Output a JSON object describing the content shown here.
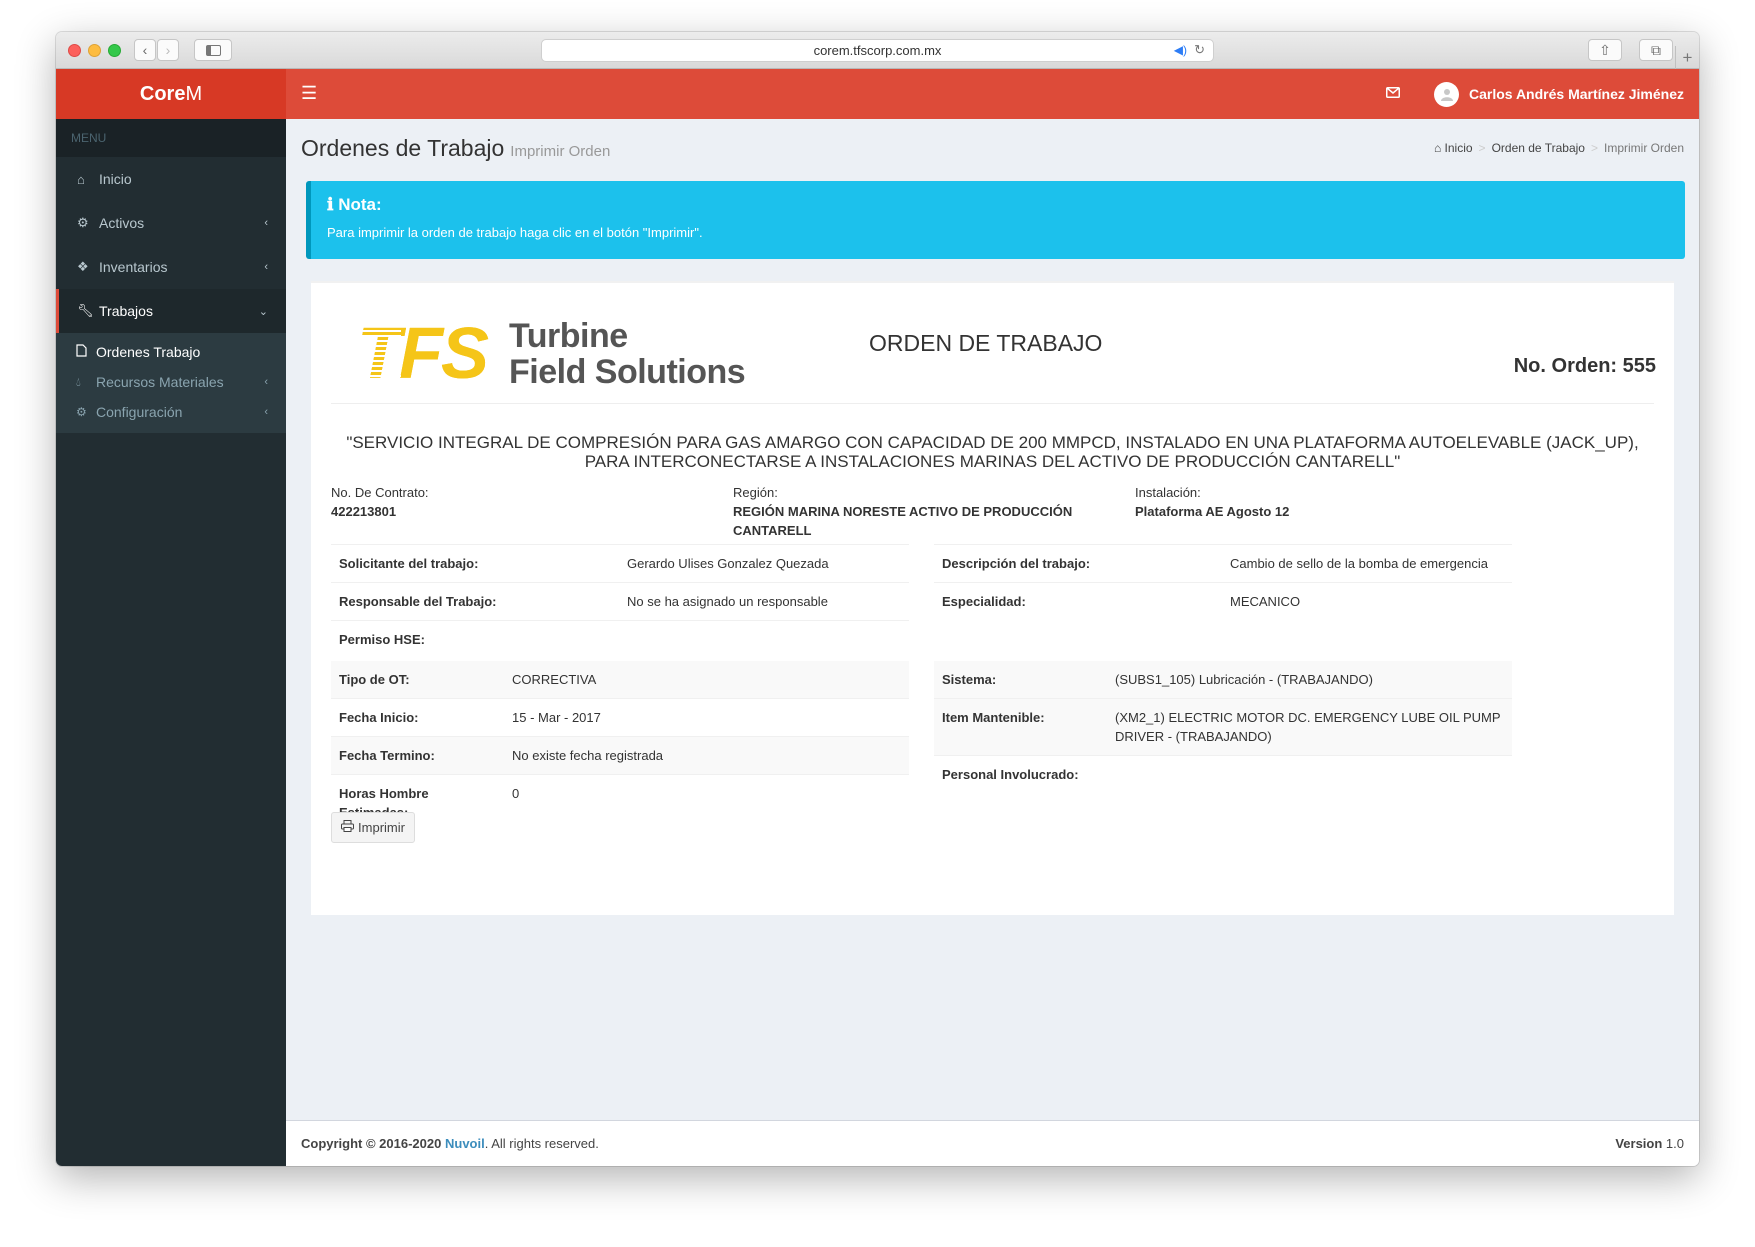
{
  "browser": {
    "url": "corem.tfscorp.com.mx"
  },
  "header": {
    "logo_bold": "Core",
    "logo_light": "M",
    "user_name": "Carlos Andrés Martínez Jiménez"
  },
  "sidebar": {
    "menu_header": "MENU",
    "items": [
      {
        "label": "Inicio",
        "icon": "home-icon"
      },
      {
        "label": "Activos",
        "icon": "cogs-icon"
      },
      {
        "label": "Inventarios",
        "icon": "cubes-icon"
      },
      {
        "label": "Trabajos",
        "icon": "wrench-icon"
      }
    ],
    "subitems": [
      {
        "label": "Ordenes Trabajo",
        "icon": "file-icon"
      },
      {
        "label": "Recursos Materiales",
        "icon": "drop-icon"
      },
      {
        "label": "Configuración",
        "icon": "gear-icon"
      }
    ]
  },
  "page": {
    "title": "Ordenes de Trabajo",
    "subtitle": "Imprimir Orden",
    "breadcrumb": [
      "Inicio",
      "Orden de Trabajo",
      "Imprimir Orden"
    ]
  },
  "note": {
    "title": "Nota:",
    "text": "Para imprimir la orden de trabajo haga clic en el botón \"Imprimir\"."
  },
  "order": {
    "company_logo_letters": "TFS",
    "company_name_1": "Turbine",
    "company_name_2": "Field Solutions",
    "doc_title": "ORDEN DE TRABAJO",
    "number": "No. Orden: 555",
    "project": "\"SERVICIO INTEGRAL DE COMPRESIÓN PARA GAS AMARGO CON CAPACIDAD DE 200 MMPCD, INSTALADO EN UNA PLATAFORMA AUTOELEVABLE (JACK_UP), PARA INTERCONECTARSE A INSTALACIONES MARINAS DEL ACTIVO DE PRODUCCIÓN CANTARELL\"",
    "contract_label": "No. De Contrato:",
    "contract_value": "422213801",
    "region_label": "Región:",
    "region_value": "REGIÓN MARINA NORESTE ACTIVO DE PRODUCCIÓN CANTARELL",
    "installation_label": "Instalación:",
    "installation_value": "Plataforma AE Agosto 12",
    "left_rows": [
      {
        "k": "Solicitante del trabajo:",
        "v": "Gerardo Ulises Gonzalez Quezada"
      },
      {
        "k": "Responsable del Trabajo:",
        "v": "No se ha asignado un responsable"
      },
      {
        "k": "Permiso HSE:",
        "v": ""
      }
    ],
    "right_rows": [
      {
        "k": "Descripción del trabajo:",
        "v": "Cambio de sello de la bomba de emergencia"
      },
      {
        "k": "Especialidad:",
        "v": "MECANICO"
      }
    ],
    "left_rows2": [
      {
        "k": "Tipo de OT:",
        "v": "CORRECTIVA"
      },
      {
        "k": "Fecha Inicio:",
        "v": "15 - Mar - 2017"
      },
      {
        "k": "Fecha Termino:",
        "v": "No existe fecha registrada"
      },
      {
        "k": "Horas Hombre Estimadas:",
        "v": "0"
      }
    ],
    "right_rows2": [
      {
        "k": "Sistema:",
        "v": "(SUBS1_105) Lubricación - (TRABAJANDO)"
      },
      {
        "k": "Item Mantenible:",
        "v": "(XM2_1) ELECTRIC MOTOR DC. EMERGENCY LUBE OIL PUMP DRIVER - (TRABAJANDO)"
      },
      {
        "k": "Personal Involucrado:",
        "v": ""
      }
    ],
    "print_button": "Imprimir"
  },
  "footer": {
    "copyright": "Copyright © 2016-2020",
    "brand": "Nuvoil",
    "rights": ". All rights reserved.",
    "version_label": "Version",
    "version_value": "1.0"
  }
}
